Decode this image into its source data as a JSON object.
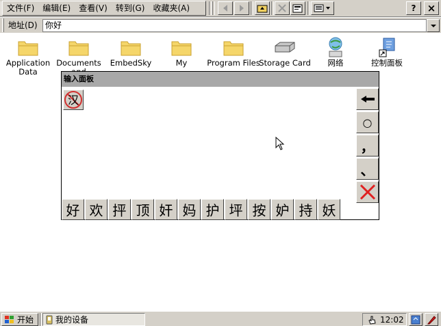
{
  "menu": {
    "items": [
      "文件(F)",
      "编辑(E)",
      "查看(V)",
      "转到(G)",
      "收藏夹(A)"
    ]
  },
  "toolbar": {
    "back_icon": "back-arrow-icon",
    "forward_icon": "forward-arrow-icon",
    "up_icon": "up-folder-icon",
    "delete_icon": "delete-x-icon",
    "properties_icon": "properties-icon",
    "view_icon": "view-menu-icon",
    "help_label": "?",
    "close_label": "×"
  },
  "address": {
    "label": "地址(D)",
    "value": "你好"
  },
  "desktop": {
    "icons": [
      {
        "label": "Application\nData",
        "icon": "folder-icon"
      },
      {
        "label": "Documents\nand",
        "icon": "folder-icon"
      },
      {
        "label": "EmbedSky",
        "icon": "folder-icon"
      },
      {
        "label": "My",
        "icon": "folder-icon"
      },
      {
        "label": "Program Files",
        "icon": "folder-icon"
      },
      {
        "label": "Storage Card",
        "icon": "storage-card-icon"
      },
      {
        "label": "网络",
        "icon": "network-icon"
      },
      {
        "label": "控制面板",
        "icon": "control-panel-icon"
      }
    ]
  },
  "input_panel": {
    "title": "输入面板",
    "mode_label": "汉",
    "candidates": [
      "好",
      "欢",
      "抨",
      "顶",
      "奸",
      "妈",
      "护",
      "坪",
      "按",
      "妒",
      "持",
      "妖"
    ],
    "side_keys": [
      "←",
      "○",
      "，",
      "、",
      "✕"
    ]
  },
  "taskbar": {
    "start_label": "开始",
    "window_label": "我的设备",
    "clock": "12:02",
    "colors": {
      "close_key": "#e02020"
    }
  }
}
